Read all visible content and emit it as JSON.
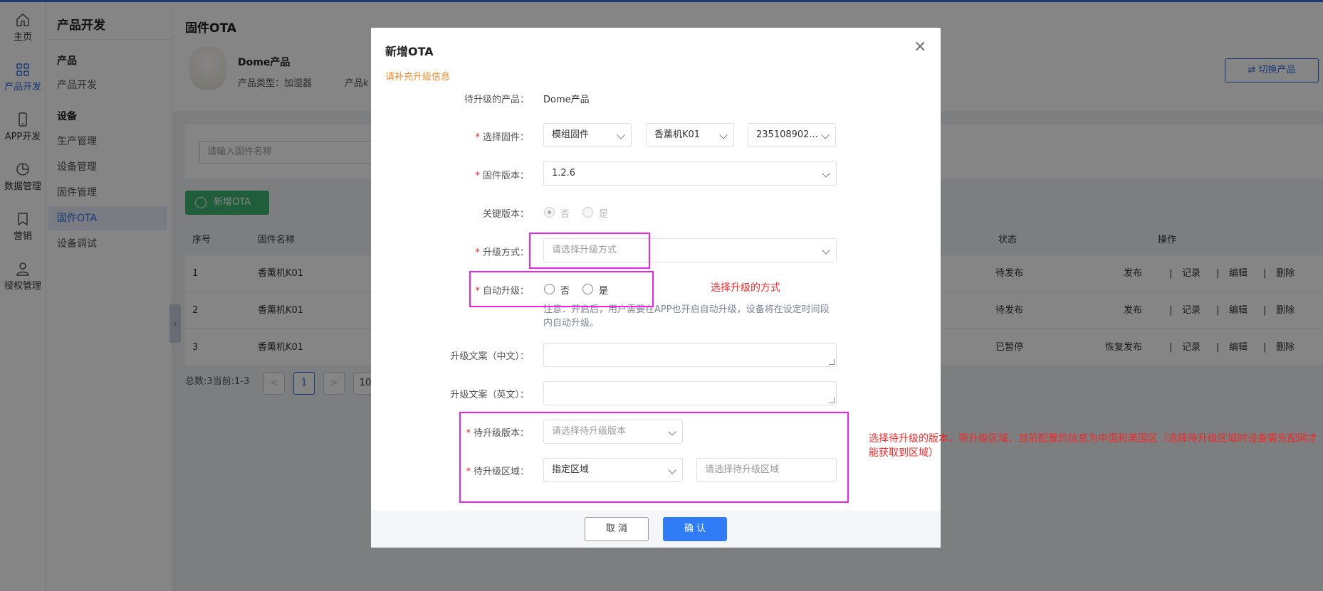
{
  "sidebar": {
    "items": [
      {
        "label": "主页",
        "icon": "home-icon"
      },
      {
        "label": "产品开发",
        "icon": "grid-icon",
        "active": true
      },
      {
        "label": "APP开发",
        "icon": "phone-icon"
      },
      {
        "label": "数据管理",
        "icon": "pie-chart-icon"
      },
      {
        "label": "营销",
        "icon": "bookmark-icon"
      },
      {
        "label": "授权管理",
        "icon": "user-icon"
      }
    ]
  },
  "submenu": {
    "title": "产品开发",
    "groups": [
      "产品",
      "设备"
    ],
    "items": [
      "产品开发",
      "生产管理",
      "设备管理",
      "固件管理",
      "固件OTA",
      "设备调试"
    ]
  },
  "page": {
    "title": "固件OTA",
    "product_name": "Dome产品",
    "product_type": "产品类型：加湿器",
    "product_k": "产品k",
    "switch_button": "切换产品",
    "search_placeholder": "请输入固件名称",
    "add_button": "新增OTA"
  },
  "table": {
    "columns": [
      "序号",
      "固件名称",
      "状态",
      "操作"
    ],
    "rows": [
      {
        "no": "1",
        "name": "香薰机K01",
        "status": "待发布",
        "ops": [
          "发布",
          "记录",
          "编辑",
          "删除"
        ]
      },
      {
        "no": "2",
        "name": "香薰机K01",
        "status": "待发布",
        "ops": [
          "发布",
          "记录",
          "编辑",
          "删除"
        ]
      },
      {
        "no": "3",
        "name": "香薰机K01",
        "status": "已暂停",
        "ops": [
          "恢复发布",
          "记录",
          "编辑",
          "删除"
        ]
      }
    ]
  },
  "pager": {
    "summary": "总数:3当前:1-3",
    "prev": "<",
    "current": "1",
    "next": ">",
    "size": "10"
  },
  "modal": {
    "title": "新增OTA",
    "close": "×",
    "notice": "请补充升级信息",
    "fields": {
      "product_label": "待升级的产品：",
      "product_value": "Dome产品",
      "firmware_label": "选择固件：",
      "firmware_type": "模组固件",
      "firmware_name": "香薰机K01",
      "firmware_id": "235108902...",
      "version_label": "固件版本：",
      "version_value": "1.2.6",
      "key_label": "关键版本：",
      "key_no": "否",
      "key_yes": "是",
      "method_label": "升级方式：",
      "method_placeholder": "请选择升级方式",
      "auto_label": "自动升级：",
      "auto_no": "否",
      "auto_yes": "是",
      "auto_hint": "注意：开启后，用户需要在APP也开启自动升级，设备将在设定时间段内自动升级。",
      "text_cn_label": "升级文案（中文）：",
      "text_en_label": "升级文案（英文）：",
      "target_version_label": "待升级版本：",
      "target_version_placeholder": "请选择待升级版本",
      "region_label": "待升级区域：",
      "region_value": "指定区域",
      "region_placeholder": "请选择待升级区域"
    },
    "cancel": "取 消",
    "ok": "确 认"
  },
  "annotations": {
    "method_note": "选择升级的方式",
    "region_note": "选择待升级的版本，带升级区域，目前配置的信息为中国和美国区（选择待升级区域时设备需先配网才能获取到区域）"
  },
  "colors": {
    "accent": "#2f6bdf",
    "add_button": "#3cb371",
    "annotation_box": "#ee22ee",
    "annotation_text": "#f02a2a",
    "notice": "#f08c2d"
  }
}
